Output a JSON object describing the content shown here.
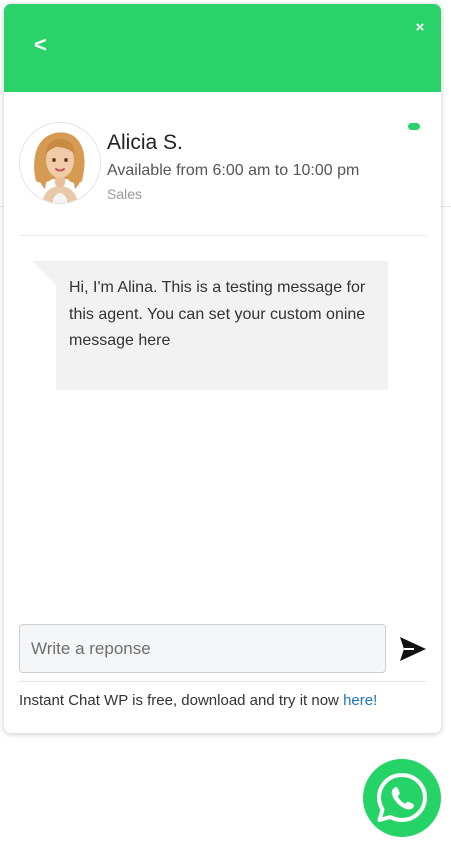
{
  "colors": {
    "brand_green": "#2ad36a",
    "whatsapp_green": "#25d366",
    "link_blue": "#1e73be"
  },
  "header": {
    "back_label": "<",
    "close_label": "×"
  },
  "agent": {
    "name": "Alicia S.",
    "hours": "Available from 6:00 am to 10:00 pm",
    "department": "Sales",
    "status": "online",
    "avatar_icon": "female-avatar-illustration"
  },
  "message": {
    "text": "Hi, I'm Alina. This is a testing message for this agent. You can set your custom onine message here"
  },
  "composer": {
    "placeholder": "Write a reponse",
    "value": "",
    "send_icon": "send-icon"
  },
  "footer": {
    "text": "Instant Chat WP is free, download and try it now ",
    "link_text": "here!"
  },
  "launcher": {
    "icon": "whatsapp-icon"
  }
}
